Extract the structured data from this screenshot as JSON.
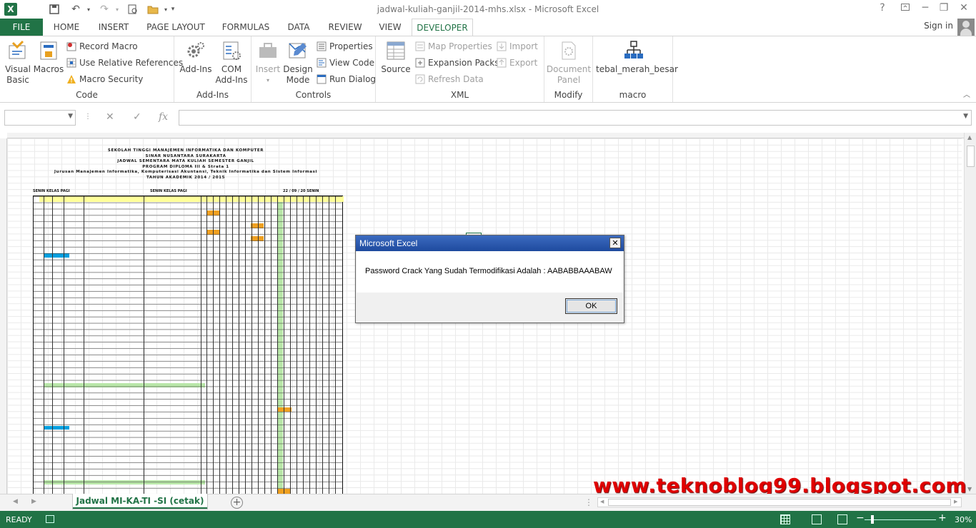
{
  "window": {
    "title": "jadwal-kuliah-ganjil-2014-mhs.xlsx - Microsoft Excel",
    "help": "?",
    "controls": [
      "─",
      "❐",
      "✕"
    ]
  },
  "qat": {
    "logo": "X"
  },
  "ribbon": {
    "file_tab": "FILE",
    "tabs": [
      "HOME",
      "INSERT",
      "PAGE LAYOUT",
      "FORMULAS",
      "DATA",
      "REVIEW",
      "VIEW",
      "DEVELOPER"
    ],
    "sign_in": "Sign in",
    "groups": {
      "code": {
        "label": "Code",
        "visual_basic": "Visual Basic",
        "macros": "Macros",
        "record_macro": "Record Macro",
        "use_relative": "Use Relative References",
        "macro_security": "Macro Security"
      },
      "addins": {
        "label": "Add-Ins",
        "addins": "Add-Ins",
        "com_addins": "COM Add-Ins"
      },
      "controls": {
        "label": "Controls",
        "insert": "Insert",
        "design_mode": "Design Mode",
        "properties": "Properties",
        "view_code": "View Code",
        "run_dialog": "Run Dialog"
      },
      "xml": {
        "label": "XML",
        "source": "Source",
        "map_properties": "Map Properties",
        "expansion_packs": "Expansion Packs",
        "refresh_data": "Refresh Data",
        "import": "Import",
        "export": "Export"
      },
      "modify": {
        "label": "Modify",
        "document_panel": "Document Panel"
      },
      "macro": {
        "label": "macro",
        "tebal_merah_besar": "tebal_merah_besar"
      }
    }
  },
  "formula_bar": {
    "name_box": "",
    "cancel": "✕",
    "enter": "✓",
    "fx": "fx",
    "value": ""
  },
  "schedule": {
    "titles": [
      "SEKOLAH TINGGI MANAJEMEN INFORMATIKA DAN KOMPUTER",
      "SINAR NUSANTARA SURAKARTA",
      "JADWAL SEMENTARA MATA KULIAH SEMESTER GANJIL",
      "PROGRAM DIPLOMA III & Strata 1",
      "Jurusan Manajemen Informatika, Komputerisasi Akuntansi, Teknik Informatika dan Sistem Informasi",
      "TAHUN AKADEMIK 2014 / 2015"
    ],
    "head_left": "SENIN KELAS PAGI",
    "head_mid": "SENIN KELAS PAGI",
    "head_right": "22 / 09 / 20 SENIN"
  },
  "dialog": {
    "title": "Microsoft Excel",
    "message": "Password Crack Yang Sudah Termodifikasi Adalah : AABABBAAABAW",
    "ok": "OK",
    "close": "✕"
  },
  "sheet_tabs": {
    "active": "Jadwal MI-KA-TI -SI (cetak)",
    "add": "+"
  },
  "status": {
    "ready": "READY",
    "zoom_minus": "−",
    "zoom_plus": "+",
    "zoom": "30%",
    "zoom_fraction": 0.3
  },
  "watermark": "www.teknoblog99.blogspot.com",
  "colors": {
    "excel_green": "#217346",
    "dialog_title": "#1e4a9e",
    "watermark": "#e00000"
  }
}
